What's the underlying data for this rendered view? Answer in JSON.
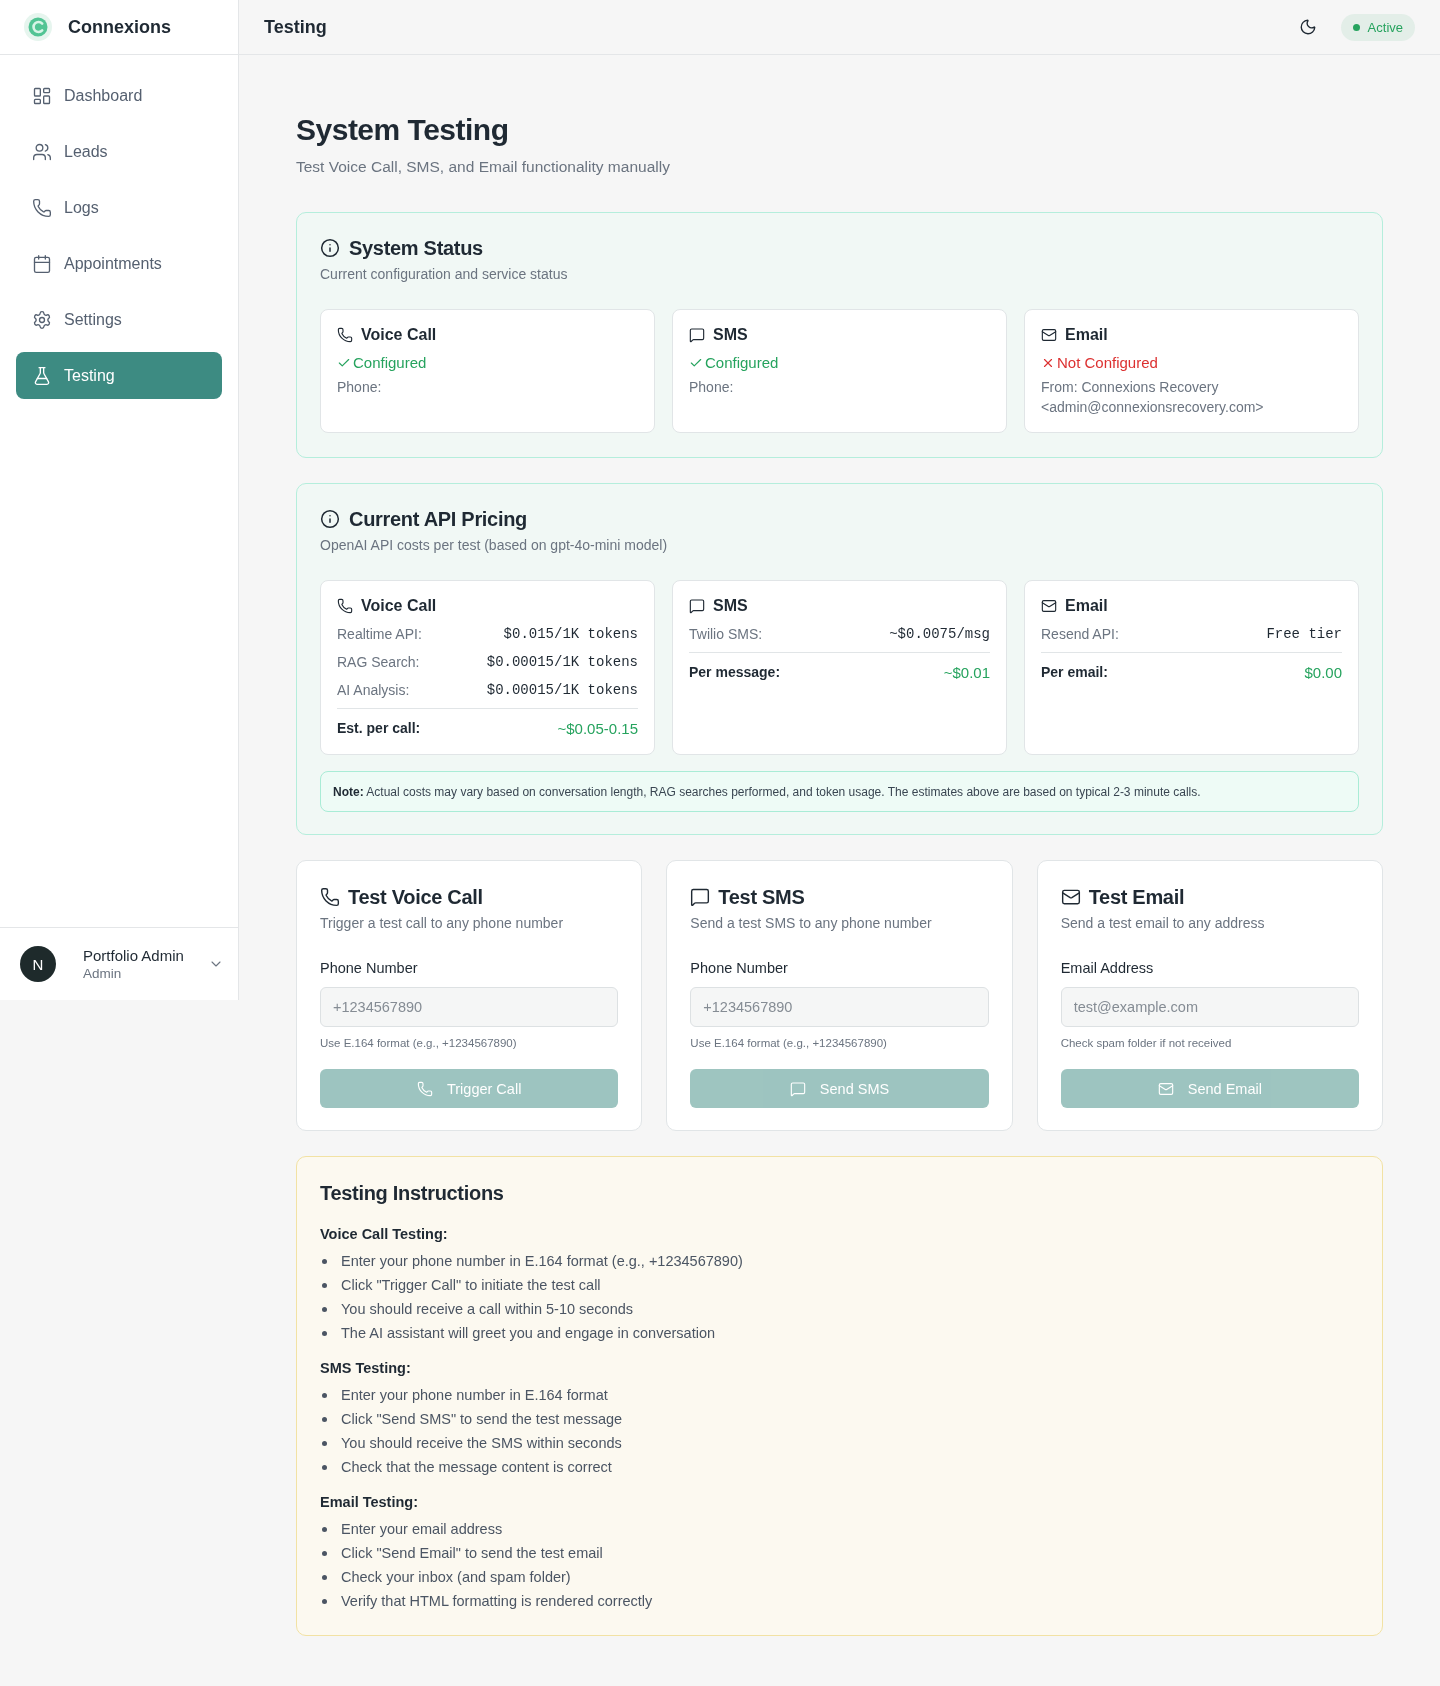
{
  "sidebar": {
    "brand": "Connexions",
    "items": [
      {
        "label": "Dashboard",
        "selected": false
      },
      {
        "label": "Leads",
        "selected": false
      },
      {
        "label": "Logs",
        "selected": false
      },
      {
        "label": "Appointments",
        "selected": false
      },
      {
        "label": "Settings",
        "selected": false
      },
      {
        "label": "Testing",
        "selected": true
      }
    ],
    "user": {
      "initial": "N",
      "name": "Portfolio Admin",
      "role": "Admin"
    }
  },
  "header": {
    "title": "Testing",
    "status": "Active"
  },
  "page": {
    "title": "System Testing",
    "subtitle": "Test Voice Call, SMS, and Email functionality manually"
  },
  "system_status": {
    "title": "System Status",
    "subtitle": "Current configuration and service status",
    "services": [
      {
        "name": "Voice Call",
        "configured": true,
        "status": "Configured",
        "details": [
          "Phone:"
        ]
      },
      {
        "name": "SMS",
        "configured": true,
        "status": "Configured",
        "details": [
          "Phone:"
        ]
      },
      {
        "name": "Email",
        "configured": false,
        "status": "Not Configured",
        "details": [
          "From: Connexions Recovery <admin@connexionsrecovery.com>"
        ]
      }
    ]
  },
  "api_pricing": {
    "title": "Current API Pricing",
    "subtitle": "OpenAI API costs per test (based on gpt-4o-mini model)",
    "services": [
      {
        "name": "Voice Call",
        "rates": [
          {
            "label": "Realtime API:",
            "value": "$0.015/1K tokens"
          },
          {
            "label": "RAG Search:",
            "value": "$0.00015/1K tokens"
          },
          {
            "label": "AI Analysis:",
            "value": "$0.00015/1K tokens"
          }
        ],
        "total": {
          "label": "Est. per call:",
          "value": "~$0.05-0.15"
        }
      },
      {
        "name": "SMS",
        "rates": [
          {
            "label": "Twilio SMS:",
            "value": "~$0.0075/msg"
          }
        ],
        "total": {
          "label": "Per message:",
          "value": "~$0.01"
        }
      },
      {
        "name": "Email",
        "rates": [
          {
            "label": "Resend API:",
            "value": "Free tier"
          }
        ],
        "total": {
          "label": "Per email:",
          "value": "$0.00"
        }
      }
    ],
    "note": "**Note:** Actual costs may vary based on conversation length, RAG searches performed, and token usage. The estimates above are based on typical 2-3 minute calls."
  },
  "tests": [
    {
      "title": "Test Voice Call",
      "subtitle": "Trigger a test call to any phone number",
      "field_label": "Phone Number",
      "placeholder": "+1234567890",
      "hint": "Use E.164 format (e.g., +1234567890)",
      "button": "Trigger Call",
      "disabled": true
    },
    {
      "title": "Test SMS",
      "subtitle": "Send a test SMS to any phone number",
      "field_label": "Phone Number",
      "placeholder": "+1234567890",
      "hint": "Use E.164 format (e.g., +1234567890)",
      "button": "Send SMS",
      "disabled": true
    },
    {
      "title": "Test Email",
      "subtitle": "Send a test email to any address",
      "field_label": "Email Address",
      "placeholder": "test@example.com",
      "hint": "Check spam folder if not received",
      "button": "Send Email",
      "disabled": true
    }
  ],
  "instructions": {
    "title": "Testing Instructions",
    "sections": [
      {
        "heading": "Voice Call Testing:",
        "items": [
          "Enter your phone number in E.164 format (e.g., +1234567890)",
          "Click \"Trigger Call\" to initiate the test call",
          "You should receive a call within 5-10 seconds",
          "The AI assistant will greet you and engage in conversation"
        ]
      },
      {
        "heading": "SMS Testing:",
        "items": [
          "Enter your phone number in E.164 format",
          "Click \"Send SMS\" to send the test message",
          "You should receive the SMS within seconds",
          "Check that the message content is correct"
        ]
      },
      {
        "heading": "Email Testing:",
        "items": [
          "Enter your email address",
          "Click \"Send Email\" to send the test email",
          "Check your inbox (and spam folder)",
          "Verify that HTML formatting is rendered correctly"
        ]
      }
    ]
  }
}
